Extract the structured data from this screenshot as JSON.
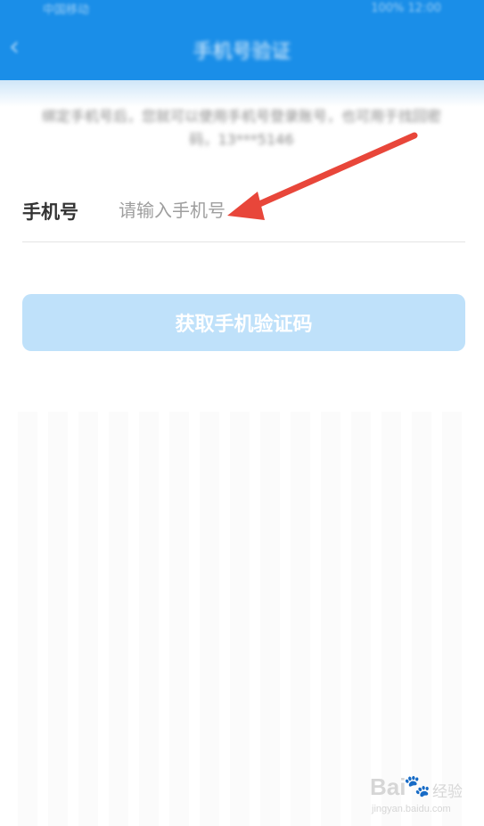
{
  "header": {
    "status_left": "中国移动",
    "status_right": "100% 12:00",
    "back_icon": "chevron-left-icon",
    "title": "手机号验证"
  },
  "notice": {
    "text": "绑定手机号后，您就可以使用手机号登录账号，也可用于找回密码，13***5146"
  },
  "form": {
    "phone_label": "手机号",
    "phone_placeholder": "请输入手机号",
    "phone_value": ""
  },
  "actions": {
    "get_code_label": "获取手机验证码"
  },
  "watermark": {
    "logo": "Bai",
    "cn": "经验",
    "url": "jingyan.baidu.com"
  },
  "colors": {
    "header_blue": "#1a8ee8",
    "button_bg": "#bfe1fa",
    "arrow_red": "#e8463a"
  }
}
